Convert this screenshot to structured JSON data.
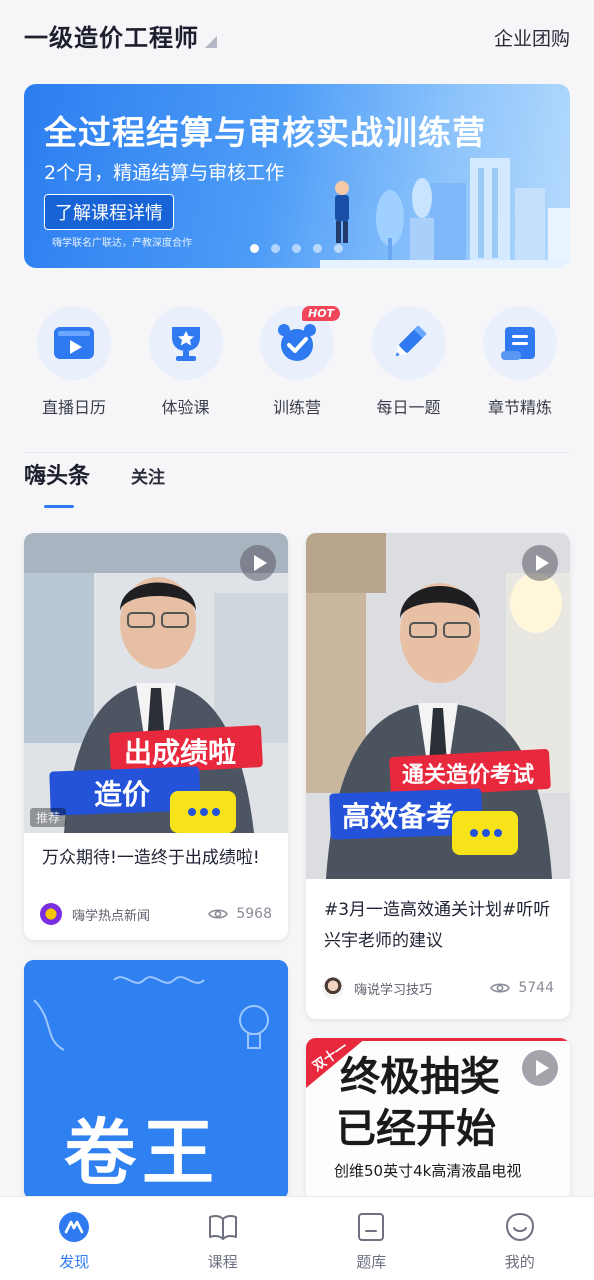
{
  "header": {
    "title": "一级造价工程师",
    "group_buy": "企业团购"
  },
  "banner": {
    "headline": "全过程结算与审核实战训练营",
    "subtitle": "2个月，精通结算与审核工作",
    "button": "了解课程详情",
    "note": "嗨学联名广联达，产教深度合作",
    "slides": 5,
    "active_slide": 1
  },
  "quick_entries": [
    {
      "label": "直播日历",
      "icon": "live-calendar-icon"
    },
    {
      "label": "体验课",
      "icon": "trophy-icon"
    },
    {
      "label": "训练营",
      "icon": "alarm-check-icon",
      "badge": "HOT"
    },
    {
      "label": "每日一题",
      "icon": "pencil-icon"
    },
    {
      "label": "章节精炼",
      "icon": "scroll-icon"
    }
  ],
  "feed": {
    "tabs": [
      {
        "label": "嗨头条",
        "active": true
      },
      {
        "label": "关注",
        "active": false
      }
    ],
    "cards": [
      {
        "title": "万众期待!一造终于出成绩啦!",
        "author": "嗨学热点新闻",
        "views": "5968",
        "tag": "推荐",
        "overlay_top": "出成绩啦",
        "overlay_bottom": "造价"
      },
      {
        "title": "#3月一造高效通关计划#听听兴宇老师的建议",
        "author": "嗨说学习技巧",
        "views": "5744",
        "overlay_top": "通关造价考试",
        "overlay_bottom": "高效备考"
      },
      {
        "overlay_main": "卷王"
      },
      {
        "overlay_ribbon": "双十一",
        "overlay_line1": "终极抽奖",
        "overlay_line2": "已经开始",
        "overlay_sub": "创维50英寸4k高清液晶电视"
      }
    ]
  },
  "bottom_nav": [
    {
      "label": "发现",
      "icon": "discover-icon",
      "active": true
    },
    {
      "label": "课程",
      "icon": "book-icon",
      "active": false
    },
    {
      "label": "题库",
      "icon": "question-bank-icon",
      "active": false
    },
    {
      "label": "我的",
      "icon": "profile-icon",
      "active": false
    }
  ],
  "colors": {
    "accent": "#2f7af0",
    "hot_badge": "#f1465a",
    "banner_blue": "#2c7ef0"
  }
}
